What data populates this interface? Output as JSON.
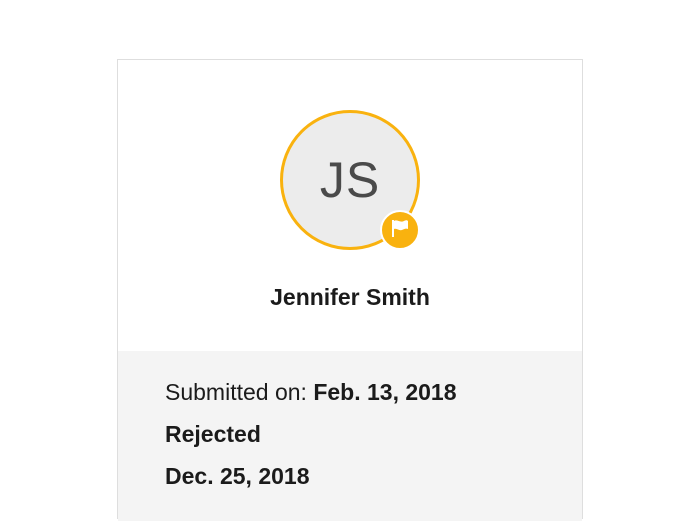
{
  "profile": {
    "initials": "JS",
    "name": "Jennifer Smith",
    "badge_icon": "flag-icon",
    "accent_color": "#f9b20f"
  },
  "details": {
    "submitted_label": "Submitted on:",
    "submitted_date": "Feb. 13, 2018",
    "status": "Rejected",
    "status_date": "Dec. 25, 2018"
  }
}
